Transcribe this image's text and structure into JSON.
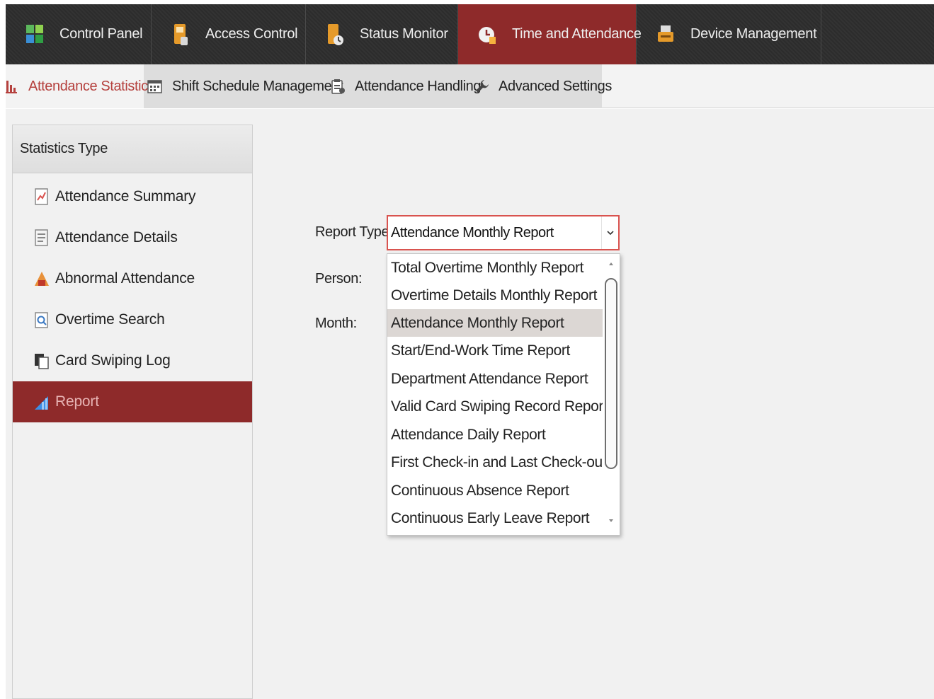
{
  "topnav": {
    "items": [
      {
        "label": "Control Panel",
        "icon": "control-panel-icon"
      },
      {
        "label": "Access Control",
        "icon": "access-control-icon"
      },
      {
        "label": "Status Monitor",
        "icon": "status-monitor-icon"
      },
      {
        "label": "Time and Attendance",
        "icon": "time-attendance-icon",
        "active": true
      },
      {
        "label": "Device Management",
        "icon": "device-management-icon"
      }
    ]
  },
  "subtabs": {
    "items": [
      {
        "label": "Attendance Statistics",
        "icon": "bar-chart-icon",
        "active": true
      },
      {
        "label": "Shift Schedule Management",
        "icon": "calendar-icon"
      },
      {
        "label": "Attendance Handling",
        "icon": "clipboard-icon"
      },
      {
        "label": "Advanced Settings",
        "icon": "wrench-icon"
      }
    ]
  },
  "sidebar": {
    "title": "Statistics Type",
    "items": [
      {
        "label": "Attendance Summary",
        "icon": "summary-icon"
      },
      {
        "label": "Attendance Details",
        "icon": "details-icon"
      },
      {
        "label": "Abnormal Attendance",
        "icon": "abnormal-icon"
      },
      {
        "label": "Overtime Search",
        "icon": "overtime-search-icon"
      },
      {
        "label": "Card Swiping Log",
        "icon": "card-log-icon"
      },
      {
        "label": "Report",
        "icon": "report-icon",
        "active": true
      }
    ]
  },
  "form": {
    "report_type_label": "Report Type:",
    "person_label": "Person:",
    "month_label": "Month:",
    "report_type_value": "Attendance Monthly Report"
  },
  "dropdown": {
    "options": [
      "Total Overtime Monthly Report",
      "Overtime Details Monthly Report",
      "Attendance Monthly Report",
      "Start/End-Work Time Report",
      "Department Attendance Report",
      "Valid Card Swiping Record Report",
      "Attendance Daily Report",
      "First Check-in and Last Check-out R...",
      "Continuous Absence Report",
      "Continuous Early Leave Report"
    ],
    "selected_index": 2
  },
  "colors": {
    "accent": "#8e2a2a",
    "active_text": "#b5413e",
    "select_border": "#d9534f"
  }
}
